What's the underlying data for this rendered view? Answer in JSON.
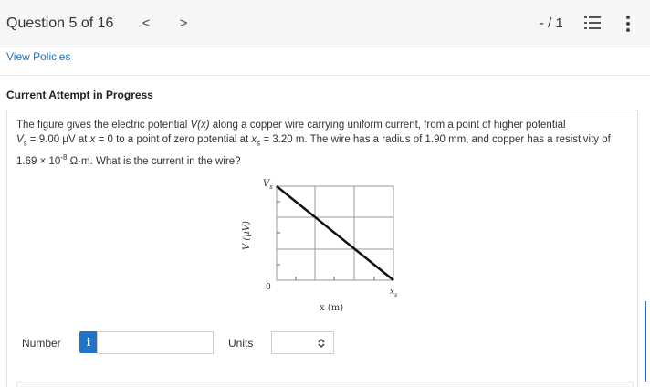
{
  "header": {
    "question_label": "Question 5 of 16",
    "prev_glyph": "<",
    "next_glyph": ">",
    "score": "- / 1",
    "list_icon": "list-icon",
    "more_icon": "more-vertical-icon"
  },
  "policies_link": "View Policies",
  "attempt_heading": "Current Attempt in Progress",
  "problem": {
    "p1": "The figure gives the electric potential ",
    "p2": "V(x)",
    "p3": " along a copper wire carrying uniform current, from a point of higher potential",
    "p4": "V",
    "p5": "s",
    "p6": " = 9.00 μV at ",
    "p7": "x",
    "p8": " = 0 to a point of zero potential at ",
    "p9": "x",
    "p10": "s",
    "p11": " = 3.20 m. The wire has a radius of 1.90 mm, and copper has a resistivity of",
    "p12": "1.69 × 10",
    "p13": "-8",
    "p14": " Ω·m. What is the current in the wire?"
  },
  "figure": {
    "y_axis_label": "V (μV)",
    "x_axis_label": "x (m)",
    "v_top": "V",
    "v_top_sub": "s",
    "origin": "0",
    "x_end": "x",
    "x_end_sub": "s"
  },
  "answer": {
    "number_label": "Number",
    "info_glyph": "i",
    "number_value": "",
    "units_label": "Units",
    "units_value": "",
    "units_chevron": "⌃⌄"
  },
  "colors": {
    "accent": "#1f73c9",
    "link": "#1a73c7",
    "topbar": "#f6f6f6"
  }
}
